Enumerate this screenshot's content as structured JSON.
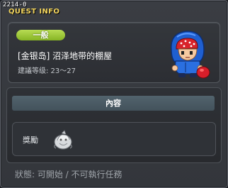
{
  "window": {
    "quest_id": "2214-0",
    "title": "QUEST INFO"
  },
  "quest": {
    "category_badge": "一般",
    "name": "[金银岛] 沼泽地带的棚屋",
    "level_requirement": "建議等级: 23～27",
    "npc_icon": "blue-hooded-npc-icon"
  },
  "content": {
    "header": "內容",
    "reward_label": "獎勵",
    "reward_icon": "reward-item-icon"
  },
  "status": "狀態: 可開始 / 不可執行任務",
  "colors": {
    "title": "#f2d45c",
    "badge": "#9cc83c",
    "window_bg": "#3a3d43"
  }
}
